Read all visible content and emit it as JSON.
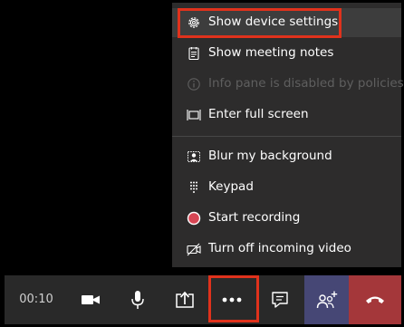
{
  "menu": {
    "items": [
      {
        "label": "Show device settings",
        "icon": "gear-icon",
        "enabled": true,
        "highlighted": true
      },
      {
        "label": "Show meeting notes",
        "icon": "notes-icon",
        "enabled": true
      },
      {
        "label": "Info pane is disabled by policies",
        "icon": "info-icon",
        "enabled": false
      },
      {
        "label": "Enter full screen",
        "icon": "fullscreen-icon",
        "enabled": true
      },
      {
        "label": "Blur my background",
        "icon": "blur-background-icon",
        "enabled": true
      },
      {
        "label": "Keypad",
        "icon": "keypad-icon",
        "enabled": true
      },
      {
        "label": "Start recording",
        "icon": "record-icon",
        "enabled": true
      },
      {
        "label": "Turn off incoming video",
        "icon": "video-off-icon",
        "enabled": true
      }
    ]
  },
  "toolbar": {
    "timer": "00:10",
    "buttons": [
      {
        "name": "camera-button",
        "icon": "camera-icon"
      },
      {
        "name": "microphone-button",
        "icon": "microphone-icon"
      },
      {
        "name": "share-screen-button",
        "icon": "share-icon"
      },
      {
        "name": "more-actions-button",
        "icon": "ellipsis-icon",
        "highlighted": true
      },
      {
        "name": "chat-button",
        "icon": "chat-icon"
      },
      {
        "name": "participants-button",
        "icon": "people-add-icon"
      },
      {
        "name": "hang-up-button",
        "icon": "phone-hangup-icon"
      }
    ]
  },
  "colors": {
    "highlight_border": "#e0321c",
    "menu_background": "#2d2c2c",
    "toolbar_background": "#292929",
    "participants_background": "#464775",
    "hangup_background": "#a4373a",
    "record_dot": "#d74654"
  }
}
